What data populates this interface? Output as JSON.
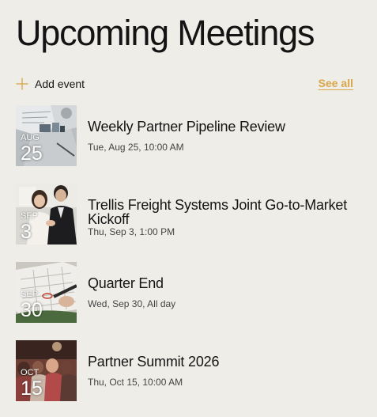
{
  "header": {
    "title": "Upcoming Meetings"
  },
  "toolbar": {
    "add_label": "Add event",
    "see_all_label": "See all",
    "accent_color": "#d9a649"
  },
  "events": [
    {
      "month": "AUG",
      "day": "25",
      "title": "Weekly Partner Pipeline Review",
      "time": "Tue, Aug 25, 10:00 AM",
      "image": "documents-desk-photo"
    },
    {
      "month": "SEP",
      "day": "3",
      "title": "Trellis Freight Systems Joint Go-to-Market Kickoff",
      "time": "Thu, Sep 3, 1:00 PM",
      "image": "handshake-meeting-photo"
    },
    {
      "month": "SEP",
      "day": "30",
      "title": "Quarter End",
      "time": "Wed, Sep 30, All day",
      "image": "calendar-pen-photo"
    },
    {
      "month": "OCT",
      "day": "15",
      "title": "Partner Summit 2026",
      "time": "Thu, Oct 15, 10:00 AM",
      "image": "conference-audience-photo"
    }
  ]
}
